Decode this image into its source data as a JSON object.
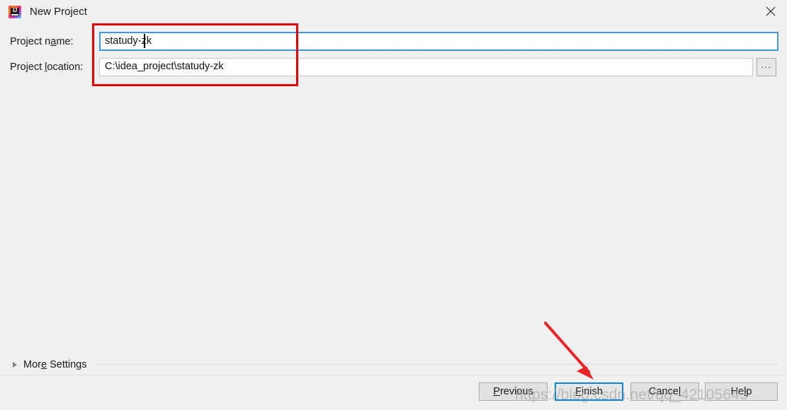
{
  "window": {
    "title": "New Project",
    "app_icon": "intellij-idea-icon",
    "icon_letters": "IJ",
    "close_label": "close-icon"
  },
  "form": {
    "name_label_pre": "Project n",
    "name_label_mnemonic": "a",
    "name_label_post": "me:",
    "name_value": "statudy-zk",
    "location_label_pre": "Project ",
    "location_label_mnemonic": "l",
    "location_label_post": "ocation:",
    "location_value": "C:\\idea_project\\statudy-zk",
    "browse_label": "...",
    "name_placeholder": "",
    "location_placeholder": ""
  },
  "more_settings": {
    "label_pre": "Mor",
    "label_mnemonic": "e",
    "label_post": " Settings",
    "expanded": false
  },
  "footer": {
    "buttons": [
      {
        "name": "previous",
        "pre": "",
        "mnemonic": "P",
        "post": "revious",
        "focused": false
      },
      {
        "name": "finish",
        "pre": "",
        "mnemonic": "F",
        "post": "inish",
        "focused": true
      },
      {
        "name": "cancel",
        "pre": "Cance",
        "mnemonic": "l",
        "post": "",
        "focused": false
      },
      {
        "name": "help",
        "pre": "He",
        "mnemonic": "l",
        "post": "p",
        "focused": false
      }
    ]
  },
  "annotations": {
    "highlight_color": "#e60000",
    "arrow_color": "#e8262a",
    "watermark_text": "https://blog.csdn.net/qq_42105643"
  },
  "colors": {
    "background": "#f0f0f0",
    "focus_blue": "#3a9ae0",
    "button_focus_blue": "#0a84d8",
    "field_white": "#ffffff",
    "button_face": "#e1e1e1"
  }
}
